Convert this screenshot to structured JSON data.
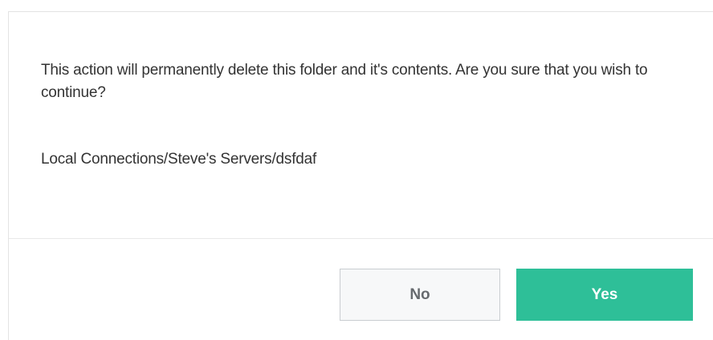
{
  "dialog": {
    "message": "This action will permanently delete this folder and it's contents.  Are you sure that you wish to continue?",
    "folder_path": "Local Connections/Steve's Servers/dsfdaf",
    "buttons": {
      "no_label": "No",
      "yes_label": "Yes"
    }
  },
  "colors": {
    "accent": "#2ebf98",
    "text": "#333333",
    "secondary_button_bg": "#f7f8f9",
    "secondary_button_border": "#c9cdd1"
  }
}
